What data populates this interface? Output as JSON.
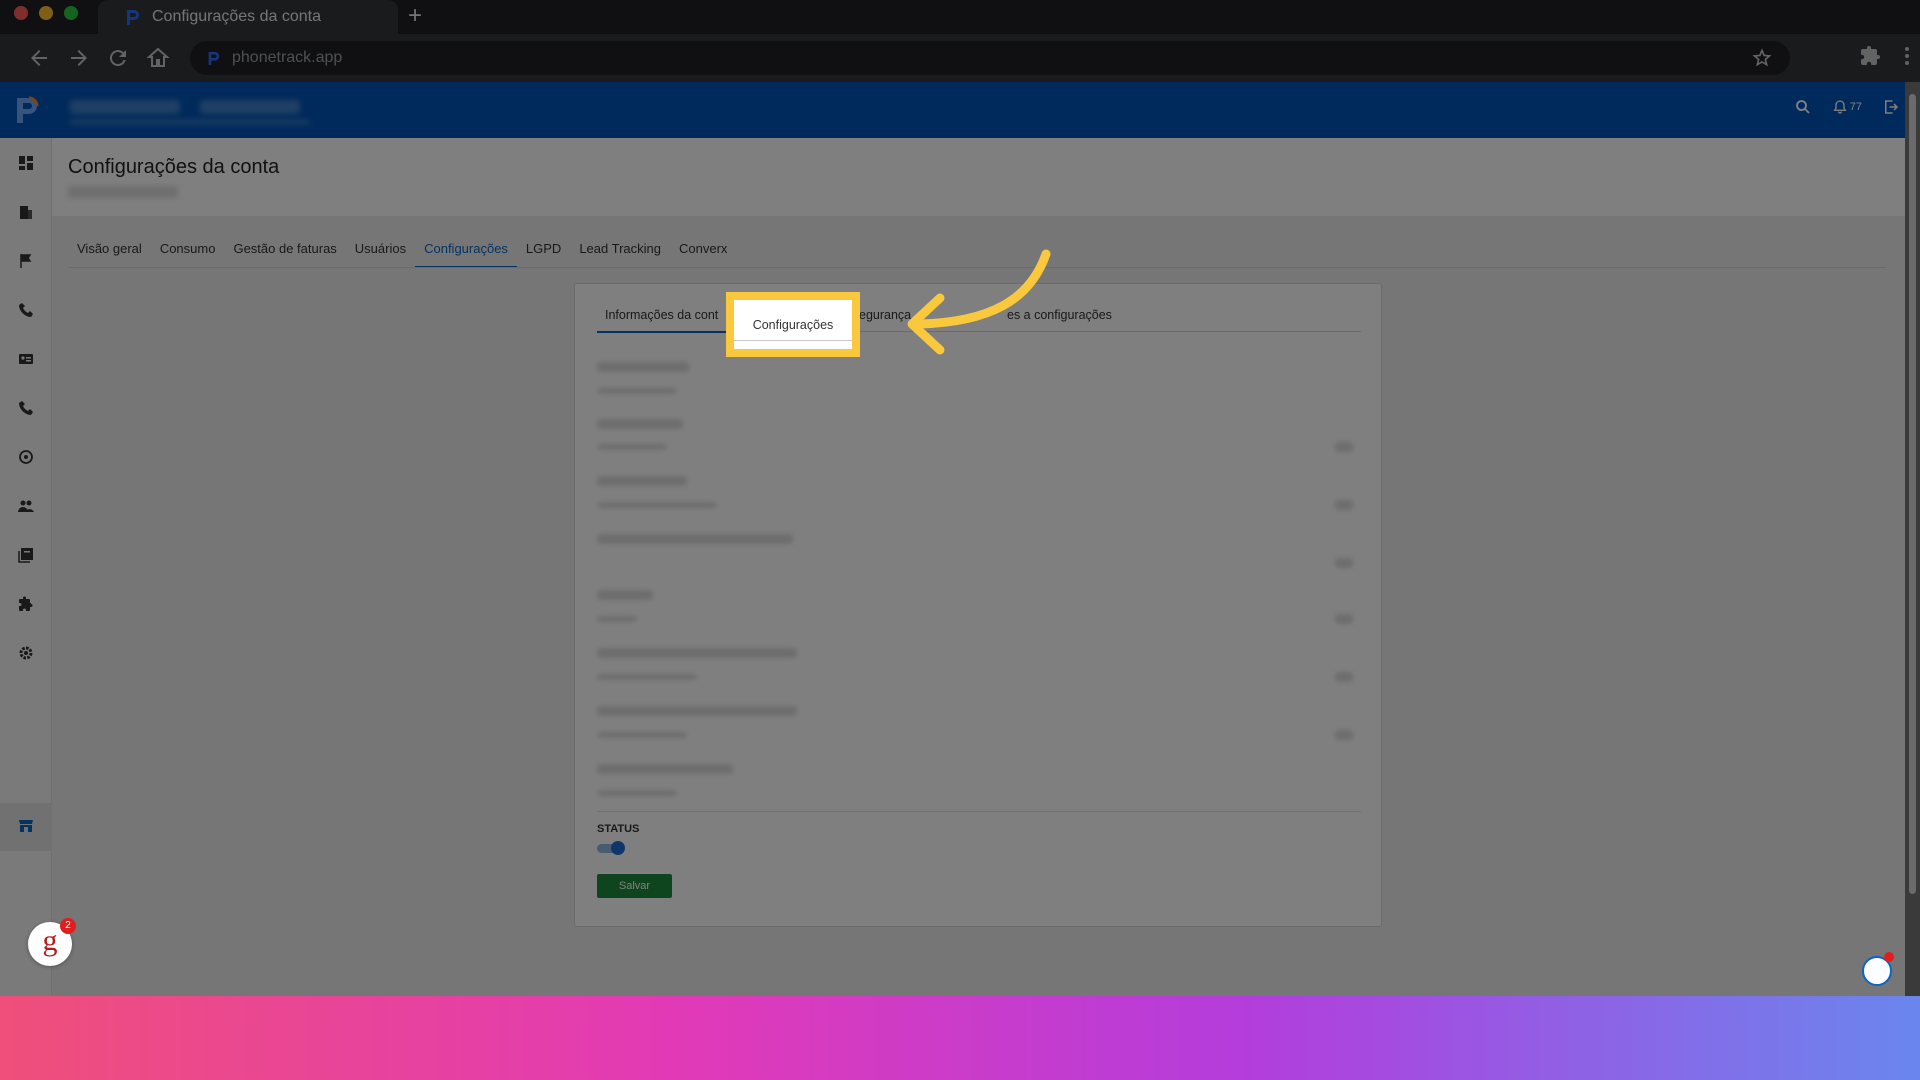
{
  "browser": {
    "tab_title": "Configurações da conta",
    "new_tab": "+",
    "url": "phonetrack.app"
  },
  "header": {
    "notification_count": "77"
  },
  "page": {
    "title": "Configurações da conta"
  },
  "tabs": [
    {
      "label": "Visão geral",
      "active": false
    },
    {
      "label": "Consumo",
      "active": false
    },
    {
      "label": "Gestão de faturas",
      "active": false
    },
    {
      "label": "Usuários",
      "active": false
    },
    {
      "label": "Configurações",
      "active": true
    },
    {
      "label": "LGPD",
      "active": false
    },
    {
      "label": "Lead Tracking",
      "active": false
    },
    {
      "label": "Converx",
      "active": false
    }
  ],
  "sub_tabs": {
    "first": "Informações da cont",
    "highlighted": "Configurações",
    "third": "egurança",
    "fourth": "es a configurações"
  },
  "form": {
    "status_label": "STATUS",
    "status_on": true,
    "save_label": "Salvar"
  },
  "widgets": {
    "g_letter": "g",
    "g_badge": "2"
  },
  "colors": {
    "brand_blue": "#0055b7",
    "accent": "#0a66c2",
    "highlight": "#f9c83d",
    "save": "#1e8a3c"
  }
}
